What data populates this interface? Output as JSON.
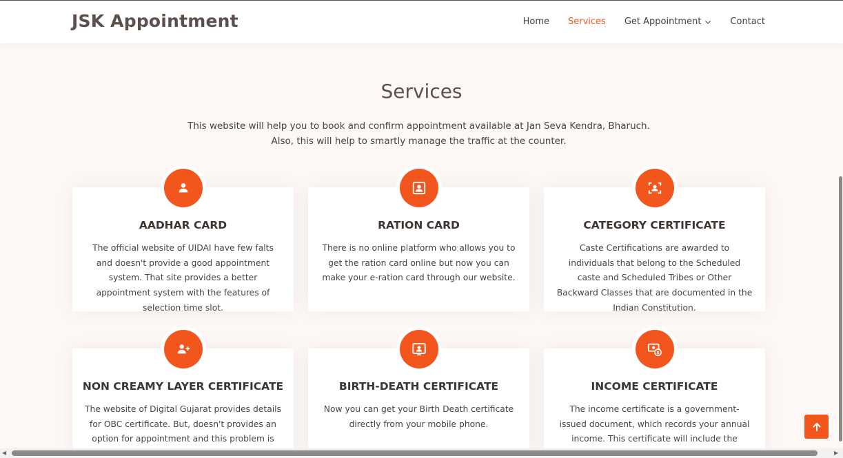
{
  "header": {
    "logo": "JSK Appointment",
    "nav": [
      {
        "label": "Home",
        "active": false
      },
      {
        "label": "Services",
        "active": true
      },
      {
        "label": "Get Appointment",
        "active": false,
        "dropdown": true
      },
      {
        "label": "Contact",
        "active": false
      }
    ]
  },
  "services": {
    "title": "Services",
    "description_line1": "This website will help you to book and confirm appointment available at Jan Seva Kendra, Bharuch.",
    "description_line2": "Also, this will help to smartly manage the traffic at the counter.",
    "cards": [
      {
        "title": "AADHAR CARD",
        "icon": "person-icon",
        "text": "The official website of UIDAI have few falts and doesn't provide a good appointment system. That site provides a better appointment system with the features of selection time slot."
      },
      {
        "title": "RATION CARD",
        "icon": "person-frame-icon",
        "text": "There is no online platform who allows you to get the ration card online but now you can make your e-ration card through our website."
      },
      {
        "title": "CATEGORY CERTIFICATE",
        "icon": "person-scan-icon",
        "text": "Caste Certifications are awarded to individuals that belong to the Scheduled caste and Scheduled Tribes or Other Backward Classes that are documented in the Indian Constitution."
      },
      {
        "title": "NON CREAMY LAYER CERTIFICATE",
        "icon": "person-add-icon",
        "text": "The website of Digital Gujarat provides details for OBC certificate. But, doesn't provides an option for appointment and this problem is"
      },
      {
        "title": "BIRTH-DEATH CERTIFICATE",
        "icon": "person-board-icon",
        "text": "Now you can get your Birth Death certificate directly from your mobile phone."
      },
      {
        "title": "INCOME CERTIFICATE",
        "icon": "money-icon",
        "text": "The income certificate is a government-issued document, which records your annual income. This certificate will include the annual income of"
      }
    ]
  },
  "colors": {
    "accent": "#f2561d",
    "background": "#fdf8f5"
  },
  "back_to_top_icon": "arrow-up-icon"
}
